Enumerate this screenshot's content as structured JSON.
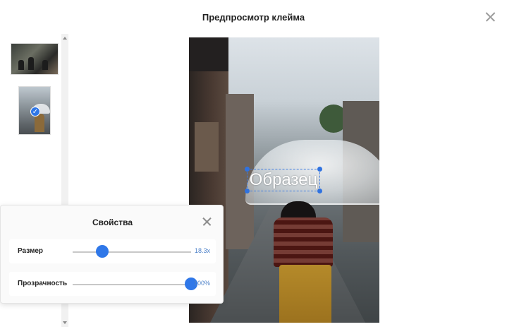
{
  "dialog": {
    "title": "Предпросмотр клейма"
  },
  "preview": {
    "watermark_text": "Образец"
  },
  "properties": {
    "title": "Свойства",
    "size": {
      "label": "Размер",
      "value": "18.3x",
      "fraction": 0.25
    },
    "opacity": {
      "label": "Прозрачность",
      "value": "100%",
      "fraction": 1.0
    }
  },
  "colors": {
    "accent": "#2f77e8",
    "value_text": "#4a7fc8"
  },
  "icons": {
    "close": "close-icon",
    "check": "check-icon"
  }
}
